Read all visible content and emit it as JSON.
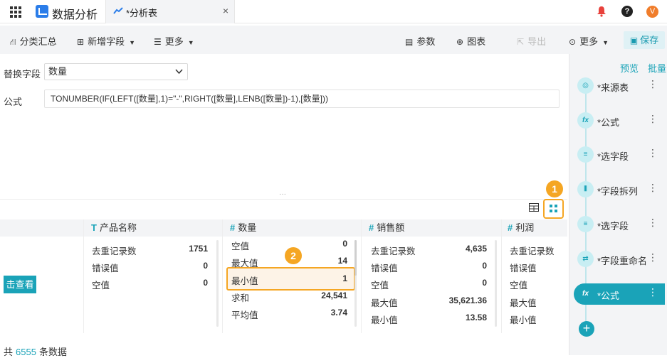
{
  "app": {
    "title": "数据分析"
  },
  "tab": {
    "label": "*分析表",
    "close": "×"
  },
  "header": {
    "help": "?",
    "avatar": "V"
  },
  "toolbar": {
    "group_summary": "分类汇总",
    "add_field": "新增字段",
    "more_left": "更多",
    "params": "参数",
    "chart": "图表",
    "export": "导出",
    "more_right": "更多",
    "save": "保存"
  },
  "form": {
    "replace_field_label": "替换字段",
    "replace_field_value": "数量",
    "formula_label": "公式",
    "formula_value": "TONUMBER(IF(LEFT([数量],1)=\"-\",RIGHT([数量],LENB([数量])-1),[数量]))"
  },
  "badges": {
    "one": "1",
    "two": "2"
  },
  "columns": [
    {
      "type": "T",
      "name": "产品名称"
    },
    {
      "type": "#",
      "name": "数量"
    },
    {
      "type": "#",
      "name": "销售额"
    },
    {
      "type": "#",
      "name": "利润"
    }
  ],
  "col1": {
    "rows": [
      {
        "label": "去重记录数",
        "value": "1751"
      },
      {
        "label": "错误值",
        "value": "0"
      },
      {
        "label": "空值",
        "value": "0"
      }
    ]
  },
  "col2": {
    "rows": [
      {
        "label": "空值",
        "value": "0"
      },
      {
        "label": "最大值",
        "value": "14"
      },
      {
        "label": "最小值",
        "value": "1"
      },
      {
        "label": "求和",
        "value": "24,541"
      },
      {
        "label": "平均值",
        "value": "3.74"
      }
    ]
  },
  "col3": {
    "rows": [
      {
        "label": "去重记录数",
        "value": "4,635"
      },
      {
        "label": "错误值",
        "value": "0"
      },
      {
        "label": "空值",
        "value": "0"
      },
      {
        "label": "最大值",
        "value": "35,621.36"
      },
      {
        "label": "最小值",
        "value": "13.58"
      }
    ]
  },
  "col4": {
    "rows": [
      {
        "label": "去重记录数"
      },
      {
        "label": "错误值"
      },
      {
        "label": "空值"
      },
      {
        "label": "最大值"
      },
      {
        "label": "最小值"
      }
    ]
  },
  "view_button": "击查看",
  "footer": {
    "prefix": "共",
    "count": "6555",
    "suffix": "条数据"
  },
  "right_panel": {
    "preview": "预览",
    "batch": "批量",
    "steps": [
      {
        "label": "*来源表",
        "icon": "source-icon"
      },
      {
        "label": "*公式",
        "icon": "formula-icon"
      },
      {
        "label": "*选字段",
        "icon": "select-field-icon"
      },
      {
        "label": "*字段拆列",
        "icon": "split-column-icon"
      },
      {
        "label": "*选字段",
        "icon": "select-field-icon"
      },
      {
        "label": "*字段重命名",
        "icon": "rename-icon"
      },
      {
        "label": "*公式",
        "icon": "formula-icon"
      }
    ],
    "add": "+"
  }
}
